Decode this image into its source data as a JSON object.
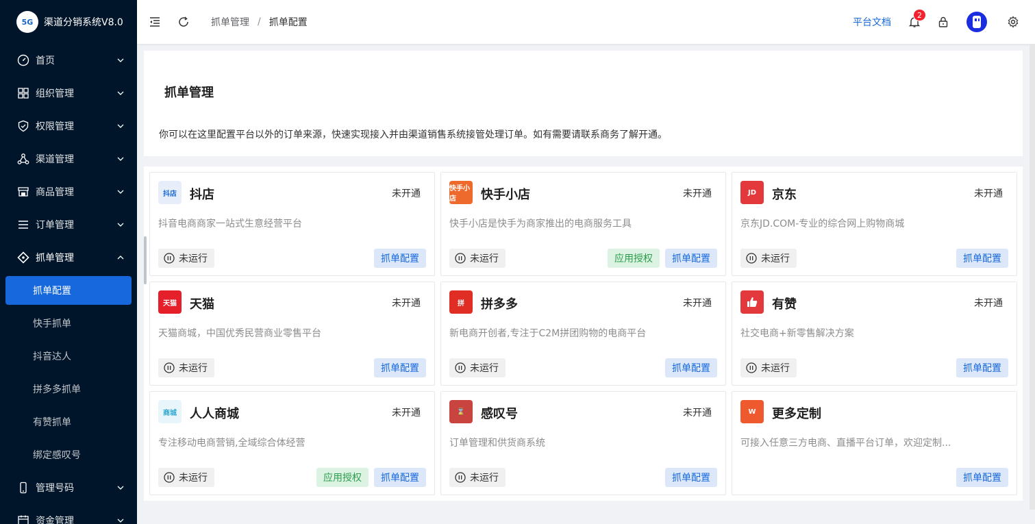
{
  "brand": {
    "logo_text": "5G",
    "title": "渠道分销系统V8.0"
  },
  "sidebar": {
    "items": [
      {
        "label": "首页",
        "icon": "dashboard-icon"
      },
      {
        "label": "组织管理",
        "icon": "grid-icon"
      },
      {
        "label": "权限管理",
        "icon": "shield-icon"
      },
      {
        "label": "渠道管理",
        "icon": "network-icon"
      },
      {
        "label": "商品管理",
        "icon": "shop-icon"
      },
      {
        "label": "订单管理",
        "icon": "list-icon"
      },
      {
        "label": "抓单管理",
        "icon": "diamond-icon"
      }
    ],
    "sub_items": [
      {
        "label": "抓单配置"
      },
      {
        "label": "快手抓单"
      },
      {
        "label": "抖音达人"
      },
      {
        "label": "拼多多抓单"
      },
      {
        "label": "有赞抓单"
      },
      {
        "label": "绑定感叹号"
      }
    ],
    "items_after": [
      {
        "label": "管理号码",
        "icon": "phone-icon"
      },
      {
        "label": "资金管理",
        "icon": "calendar-icon"
      }
    ]
  },
  "header": {
    "breadcrumb": [
      "抓单管理",
      "抓单配置"
    ],
    "breadcrumb_sep": "/",
    "doc_link": "平台文档",
    "notification_count": "2"
  },
  "intro": {
    "title": "抓单管理",
    "description": "你可以在这里配置平台以外的订单来源，快速实现接入并由渠道销售系统接管处理订单。如有需要请联系商务了解开通。"
  },
  "labels": {
    "not_running": "未运行",
    "config_btn": "抓单配置",
    "auth_btn": "应用授权"
  },
  "colors": {
    "sidebar_bg": "#001529",
    "accent": "#1668dc",
    "auth_green": "#2c9e4b"
  },
  "cards": [
    {
      "name": "抖店",
      "status": "未开通",
      "desc": "抖音电商商家一站式生意经营平台",
      "logo_text": "抖店",
      "logo_color": "#e8eef9",
      "show_run": true,
      "show_auth": false
    },
    {
      "name": "快手小店",
      "status": "未开通",
      "desc": "快手小店是快手为商家推出的电商服务工具",
      "logo_text": "快手小店",
      "logo_color": "#ee6a2c",
      "show_run": true,
      "show_auth": true
    },
    {
      "name": "京东",
      "status": "未开通",
      "desc": "京东JD.COM-专业的综合网上购物商城",
      "logo_text": "JD",
      "logo_color": "#e4393c",
      "show_run": true,
      "show_auth": false
    },
    {
      "name": "天猫",
      "status": "未开通",
      "desc": "天猫商城，中国优秀民营商业零售平台",
      "logo_text": "天猫",
      "logo_color": "#e5202a",
      "show_run": true,
      "show_auth": false
    },
    {
      "name": "拼多多",
      "status": "未开通",
      "desc": "新电商开创者,专注于C2M拼团购物的电商平台",
      "logo_text": "拼",
      "logo_color": "#e02e24",
      "show_run": true,
      "show_auth": false
    },
    {
      "name": "有赞",
      "status": "未开通",
      "desc": "社交电商+新零售解决方案",
      "logo_text": "赞",
      "logo_color": "#e4393c",
      "show_run": true,
      "show_auth": false
    },
    {
      "name": "人人商城",
      "status": "未开通",
      "desc": "专注移动电商营销,全域综合体经营",
      "logo_text": "商城",
      "logo_color": "#e8f6fb",
      "show_run": true,
      "show_auth": true
    },
    {
      "name": "感叹号",
      "status": "未开通",
      "desc": "订单管理和供货商系统",
      "logo_text": "⌛",
      "logo_color": "#c9433f",
      "show_run": true,
      "show_auth": false
    },
    {
      "name": "更多定制",
      "status": "",
      "desc": "可接入任意三方电商、直播平台订单，欢迎定制...",
      "logo_text": "W",
      "logo_color": "#ee5a2e",
      "show_run": false,
      "show_auth": false
    }
  ]
}
